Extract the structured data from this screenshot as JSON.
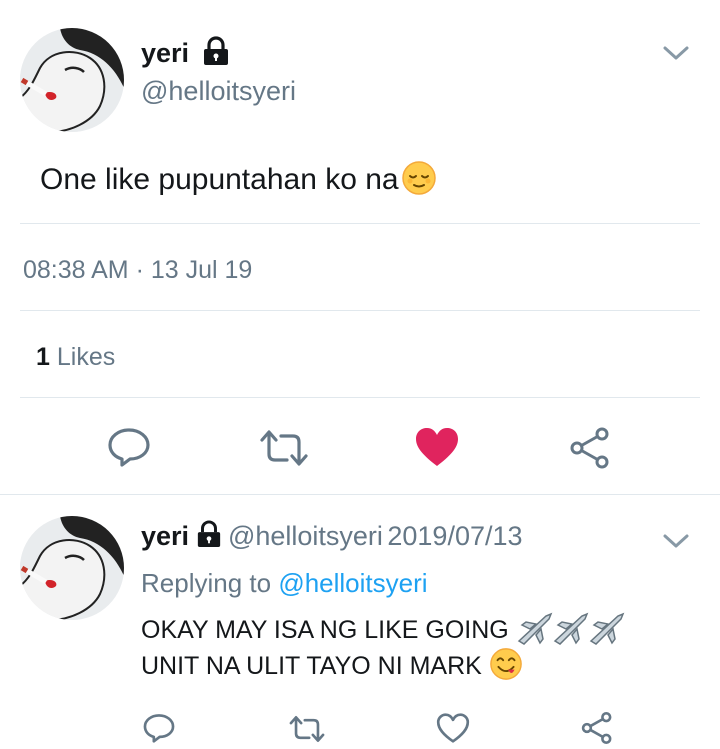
{
  "main_tweet": {
    "author_name": "yeri",
    "author_handle": "@helloitsyeri",
    "text": "One like pupuntahan ko na",
    "emoji": "relieved-face",
    "time": "08:38 AM",
    "separator": "·",
    "date": "13 Jul 19",
    "likes_count": "1",
    "likes_label": "Likes",
    "liked": true
  },
  "reply_tweet": {
    "author_name": "yeri",
    "author_handle": "@helloitsyeri",
    "date": "2019/07/13",
    "replying_label": "Replying to",
    "replying_to": "@helloitsyeri",
    "line1": "OKAY MAY ISA NG LIKE GOING",
    "line1_emoji": "airplane",
    "line2": "UNIT NA ULIT TAYO NI MARK",
    "line2_emoji": "face-savoring-food",
    "liked": false
  },
  "colors": {
    "like_active": "#e0245e",
    "muted": "#657786",
    "link": "#1da1f2",
    "divider": "#e1e8ed"
  },
  "icons": [
    "lock-icon",
    "chevron-down-icon",
    "reply-icon",
    "retweet-icon",
    "heart-icon",
    "share-icon"
  ]
}
